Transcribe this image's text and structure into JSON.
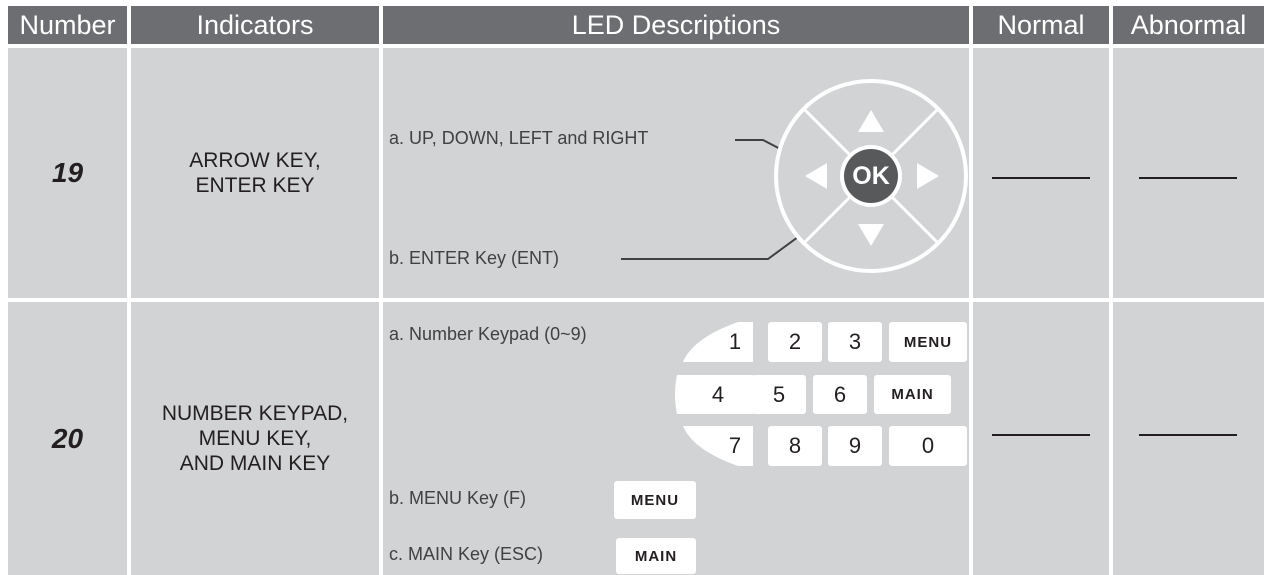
{
  "header": {
    "number": "Number",
    "indicators": "Indicators",
    "led_descriptions": "LED Descriptions",
    "normal": "Normal",
    "abnormal": "Abnormal"
  },
  "rows": [
    {
      "number": "19",
      "indicator_lines": [
        "ARROW KEY,",
        "ENTER KEY"
      ],
      "desc_a": "a. UP, DOWN, LEFT and RIGHT",
      "desc_b": "b. ENTER Key (ENT)",
      "ok_label": "OK",
      "normal": "———",
      "abnormal": "———"
    },
    {
      "number": "20",
      "indicator_lines": [
        "NUMBER KEYPAD,",
        "MENU KEY,",
        "AND MAIN KEY"
      ],
      "desc_a": "a. Number Keypad (0~9)",
      "desc_b": "b. MENU Key (F)",
      "desc_c": "c. MAIN Key (ESC)",
      "keys": {
        "k1": "1",
        "k2": "2",
        "k3": "3",
        "menu": "MENU",
        "k4": "4",
        "k5": "5",
        "k6": "6",
        "main": "MAIN",
        "k7": "7",
        "k8": "8",
        "k9": "9",
        "k0": "0"
      },
      "menu_key_label": "MENU",
      "main_key_label": "MAIN",
      "normal": "———",
      "abnormal": "———"
    }
  ],
  "colors": {
    "header_bg": "#6d6e71",
    "body_bg": "#d1d3d4",
    "key_bg": "#ffffff",
    "ok_button": "#58595b"
  }
}
